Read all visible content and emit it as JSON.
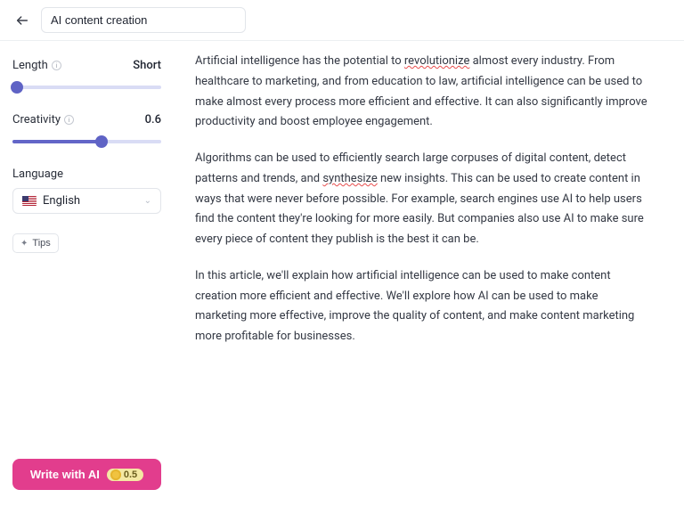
{
  "topbar": {
    "title_value": "AI content creation"
  },
  "sidebar": {
    "length": {
      "label": "Length",
      "value": "Short",
      "fill_pct": 3
    },
    "creativity": {
      "label": "Creativity",
      "value": "0.6",
      "fill_pct": 60
    },
    "language": {
      "label": "Language",
      "selected": "English"
    },
    "tips_label": "Tips",
    "cta_label": "Write with AI",
    "cta_credit": "0.5"
  },
  "content": {
    "p1_a": "Artificial intelligence has the potential to ",
    "p1_sq1": "revolutionize",
    "p1_b": " almost every industry. From healthcare to marketing, and from education to law, artificial intelligence can be used to make almost every process more efficient and effective. It can also significantly improve productivity and boost employee engagement.",
    "p2_a": "Algorithms can be used to efficiently search large corpuses of digital content, detect patterns and trends, and ",
    "p2_sq1": "synthesize",
    "p2_b": " new insights. This can be used to create content in ways that were never before possible. For example, search engines use AI to help users find the content they're looking for more easily. But companies also use AI to make sure every piece of content they publish is the best it can be.",
    "p3": "In this article, we'll explain how artificial intelligence can be used to make content creation more efficient and effective. We'll explore how AI can be used to make marketing more effective, improve the quality of content, and make content marketing more profitable for businesses."
  }
}
